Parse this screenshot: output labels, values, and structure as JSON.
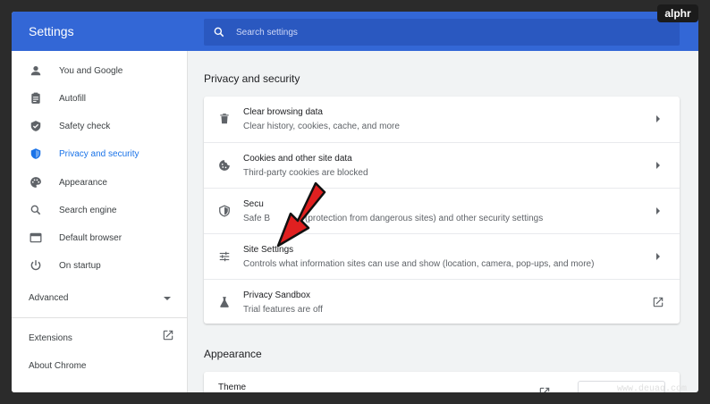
{
  "app": {
    "title": "Settings"
  },
  "search": {
    "placeholder": "Search settings",
    "icon": "search-icon"
  },
  "sidebar": {
    "items": [
      {
        "label": "You and Google",
        "icon": "person-icon",
        "active": false
      },
      {
        "label": "Autofill",
        "icon": "clipboard-icon",
        "active": false
      },
      {
        "label": "Safety check",
        "icon": "shield-check-icon",
        "active": false
      },
      {
        "label": "Privacy and security",
        "icon": "shield-icon",
        "active": true
      },
      {
        "label": "Appearance",
        "icon": "palette-icon",
        "active": false
      },
      {
        "label": "Search engine",
        "icon": "search-icon",
        "active": false
      },
      {
        "label": "Default browser",
        "icon": "browser-icon",
        "active": false
      },
      {
        "label": "On startup",
        "icon": "power-icon",
        "active": false
      }
    ],
    "advanced_label": "Advanced",
    "extensions_label": "Extensions",
    "about_label": "About Chrome"
  },
  "main": {
    "privacy": {
      "title": "Privacy and security",
      "rows": [
        {
          "title": "Clear browsing data",
          "subtitle": "Clear history, cookies, cache, and more",
          "icon": "trash-icon",
          "action": "arrow"
        },
        {
          "title": "Cookies and other site data",
          "subtitle": "Third-party cookies are blocked",
          "icon": "cookie-icon",
          "action": "arrow"
        },
        {
          "title": "Secu",
          "subtitle": "Safe B",
          "subtitle_tail": "(protection from dangerous sites) and other security settings",
          "icon": "security-shield-icon",
          "action": "arrow"
        },
        {
          "title": "Site Settings",
          "subtitle": "Controls what information sites can use and show (location, camera, pop-ups, and more)",
          "icon": "tune-icon",
          "action": "arrow"
        },
        {
          "title": "Privacy Sandbox",
          "subtitle": "Trial features are off",
          "icon": "flask-icon",
          "action": "external"
        }
      ]
    },
    "appearance": {
      "title": "Appearance",
      "theme_label": "Theme"
    }
  },
  "overlay": {
    "logo_text": "alphr",
    "watermark": "www.deuaq.com"
  },
  "colors": {
    "accent": "#3367d6",
    "active": "#1a73e8",
    "annotation": "#e02020"
  }
}
